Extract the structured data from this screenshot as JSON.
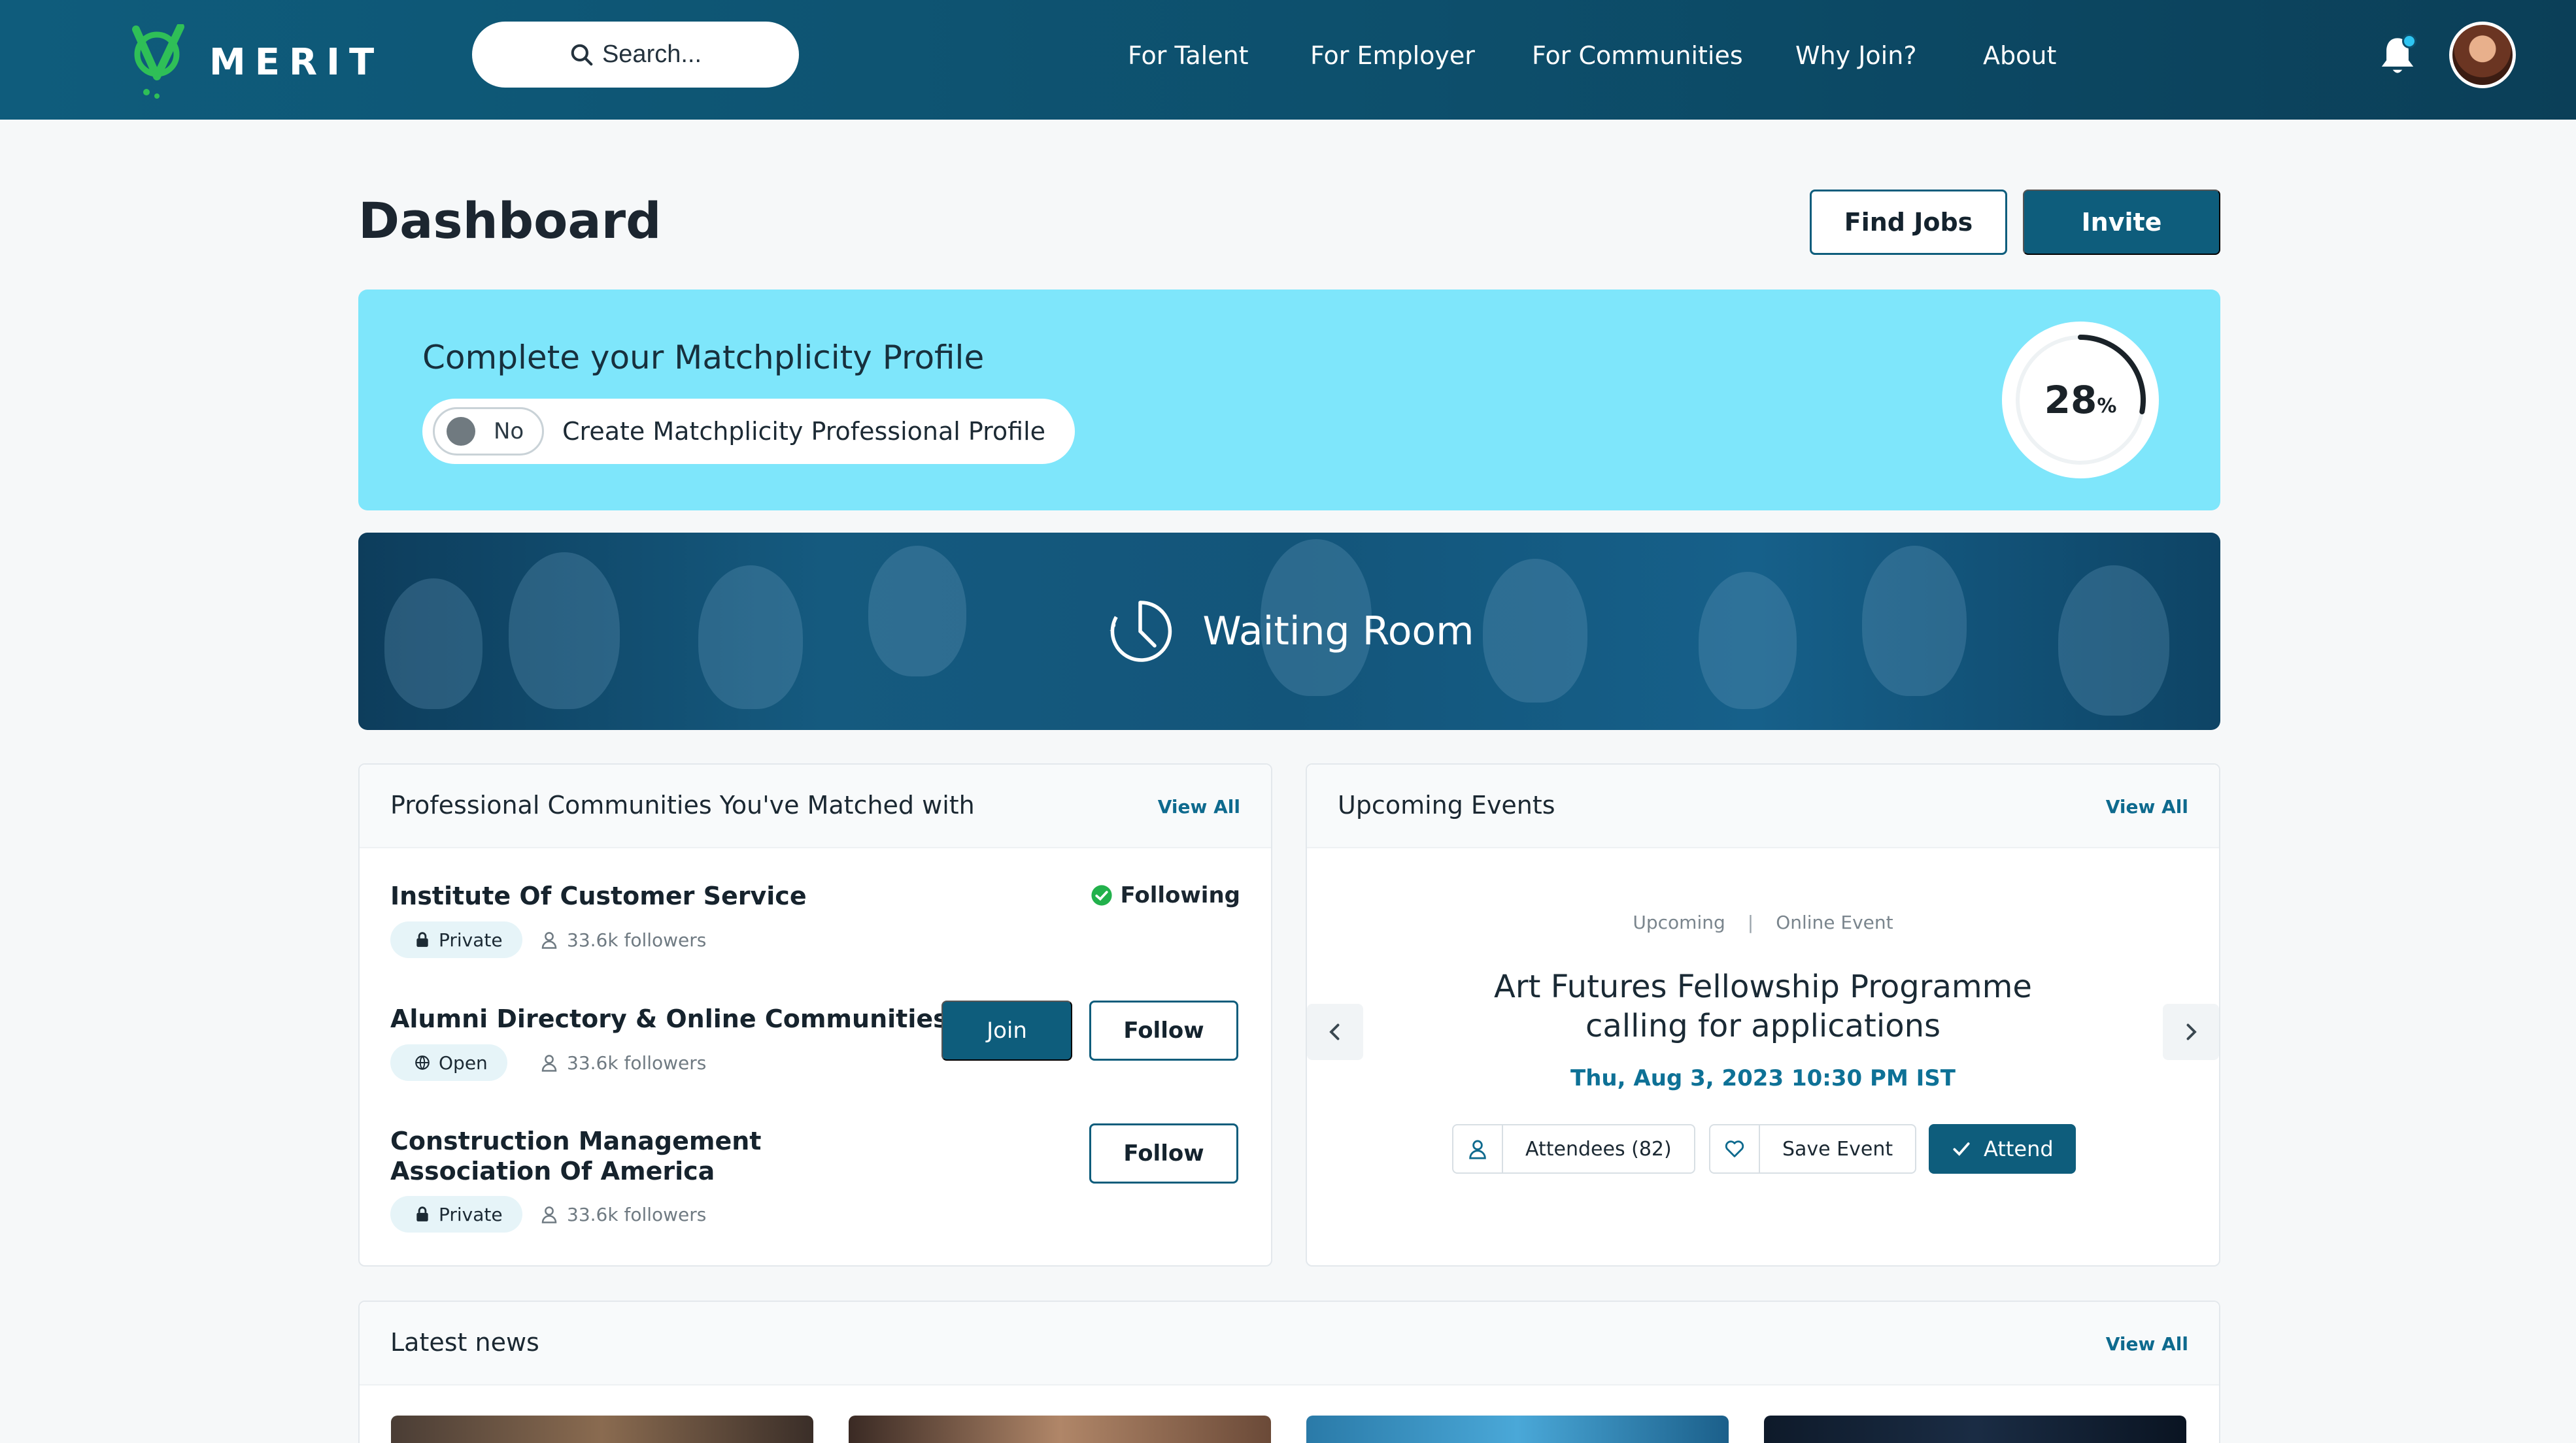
{
  "nav": {
    "brand": "MERIT",
    "search_placeholder": "Search...",
    "links": [
      "For Talent",
      "For Employer",
      "For Communities",
      "Why Join?",
      "About"
    ]
  },
  "header": {
    "title": "Dashboard",
    "find_jobs": "Find Jobs",
    "invite": "Invite"
  },
  "profile": {
    "title": "Complete your Matchplicity Profile",
    "toggle_state": "No",
    "toggle_label": "Create Matchplicity Professional Profile",
    "progress_value": "28",
    "progress_unit": "%",
    "progress_fraction": 0.28
  },
  "waiting_room": {
    "label": "Waiting Room"
  },
  "communities": {
    "title": "Professional Communities You've Matched with",
    "view_all": "View All",
    "items": [
      {
        "name": "Institute Of Customer Service",
        "privacy": "Private",
        "followers": "33.6k followers",
        "status": "Following"
      },
      {
        "name": "Alumni Directory & Online Communities",
        "privacy": "Open",
        "followers": "33.6k followers",
        "join": "Join",
        "follow": "Follow"
      },
      {
        "name": "Construction Management Association Of America",
        "privacy": "Private",
        "followers": "33.6k followers",
        "follow": "Follow"
      }
    ]
  },
  "events": {
    "title": "Upcoming Events",
    "view_all": "View All",
    "status": "Upcoming",
    "kind": "Online Event",
    "event_title": "Art Futures Fellowship Programme calling for applications",
    "date": "Thu, Aug 3, 2023 10:30 PM IST",
    "attendees": "Attendees (82)",
    "save": "Save Event",
    "attend": "Attend"
  },
  "news": {
    "title": "Latest news",
    "view_all": "View All"
  },
  "colors": {
    "nav": "#0f5c7c",
    "accent": "#0e5d7c",
    "profile_bg": "#7ee6fb",
    "success": "#22b14c"
  },
  "icons": [
    "logo-icon",
    "search-icon",
    "bell-icon",
    "clock-icon",
    "lock-icon",
    "globe-icon",
    "user-icon",
    "check-circle-icon",
    "chevron-left-icon",
    "chevron-right-icon",
    "heart-icon",
    "check-icon"
  ]
}
